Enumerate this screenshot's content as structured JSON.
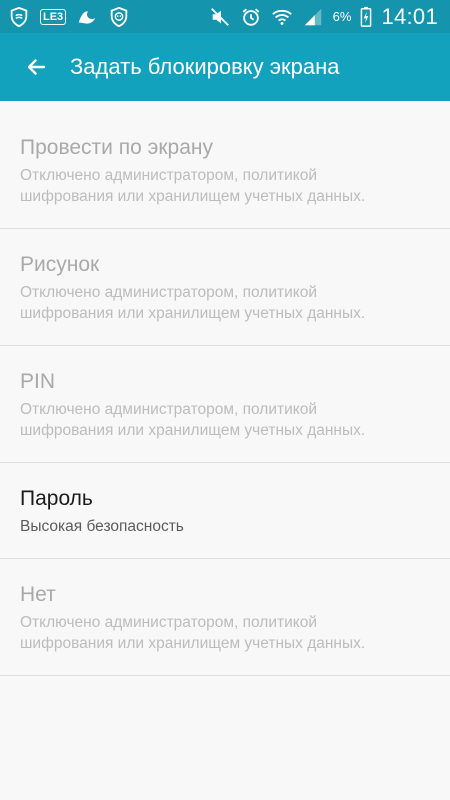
{
  "status_bar": {
    "left_icons": [
      "shield-icon",
      "lte-badge-icon",
      "wave-icon",
      "lion-shield-icon"
    ],
    "lte_badge": "LE3",
    "right_icons": [
      "mute-icon",
      "alarm-icon",
      "wifi-icon",
      "signal-icon",
      "battery-charging-icon"
    ],
    "battery_percent": "6%",
    "time": "14:01"
  },
  "toolbar": {
    "back_icon": "arrow-left-icon",
    "title": "Задать блокировку экрана"
  },
  "colors": {
    "status_bar_bg": "#1594ad",
    "toolbar_bg": "#13a2bd",
    "page_bg": "#f8f8f8",
    "divider": "#dedede",
    "disabled_text": "#a9a9a9",
    "enabled_text": "#1b1b1b"
  },
  "options": [
    {
      "title": "Провести по экрану",
      "subtitle": "Отключено администратором, политикой\nшифрования или хранилищем учетных данных.",
      "enabled": false
    },
    {
      "title": "Рисунок",
      "subtitle": "Отключено администратором, политикой\nшифрования или хранилищем учетных данных.",
      "enabled": false
    },
    {
      "title": "PIN",
      "subtitle": "Отключено администратором, политикой\nшифрования или хранилищем учетных данных.",
      "enabled": false
    },
    {
      "title": "Пароль",
      "subtitle": "Высокая безопасность",
      "enabled": true
    },
    {
      "title": "Нет",
      "subtitle": "Отключено администратором, политикой\nшифрования или хранилищем учетных данных.",
      "enabled": false
    }
  ]
}
